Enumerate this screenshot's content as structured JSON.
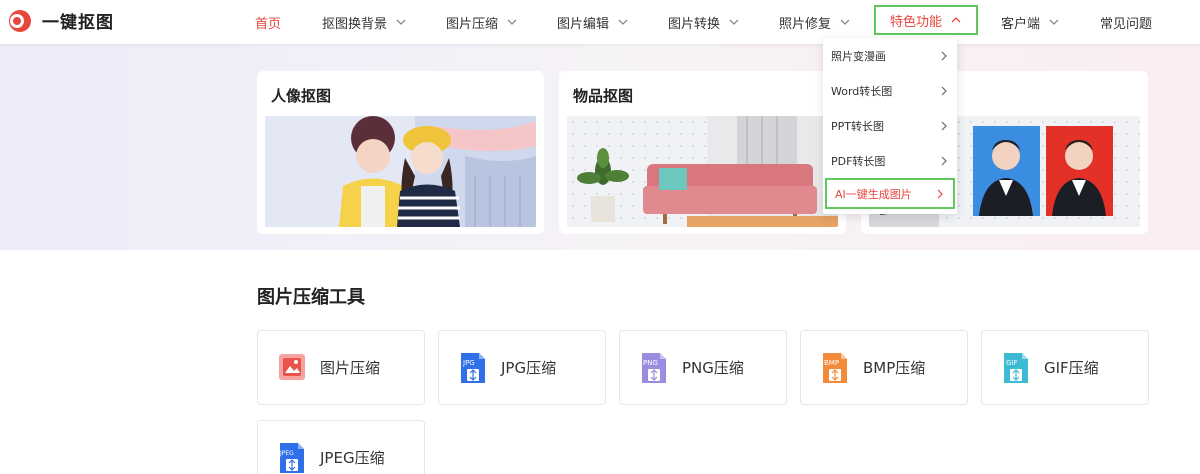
{
  "brand": {
    "name": "一键抠图",
    "accent": "#e8453c",
    "highlight": "#5fc95f"
  },
  "nav": {
    "home": "首页",
    "bg_remove": "抠图换背景",
    "compress": "图片压缩",
    "edit": "图片编辑",
    "convert": "图片转换",
    "repair": "照片修复",
    "features": "特色功能",
    "client": "客户端",
    "faq": "常见问题"
  },
  "dropdown": {
    "items": [
      {
        "label": "照片变漫画",
        "icon": "chevron-right-icon"
      },
      {
        "label": "Word转长图",
        "icon": "chevron-right-icon"
      },
      {
        "label": "PPT转长图",
        "icon": "chevron-right-icon"
      },
      {
        "label": "PDF转长图",
        "icon": "chevron-right-icon"
      },
      {
        "label": "AI一键生成图片",
        "icon": "chevron-right-icon"
      }
    ]
  },
  "hero": {
    "cards": [
      {
        "title": "人像抠图"
      },
      {
        "title": "物品抠图"
      },
      {
        "title": ""
      }
    ]
  },
  "tools": {
    "section_title": "图片压缩工具",
    "items": [
      {
        "label": "图片压缩",
        "icon": "image-compress-icon",
        "badge": ""
      },
      {
        "label": "JPG压缩",
        "icon": "jpg-file-icon",
        "badge": "JPG",
        "color": "#2f6fe8"
      },
      {
        "label": "PNG压缩",
        "icon": "png-file-icon",
        "badge": "PNG",
        "color": "#9b8ce0"
      },
      {
        "label": "BMP压缩",
        "icon": "bmp-file-icon",
        "badge": "BMP",
        "color": "#f28a3a"
      },
      {
        "label": "GIF压缩",
        "icon": "gif-file-icon",
        "badge": "GIF",
        "color": "#3bbad1"
      },
      {
        "label": "JPEG压缩",
        "icon": "jpeg-file-icon",
        "badge": "JPEG",
        "color": "#2f6fe8"
      }
    ]
  }
}
